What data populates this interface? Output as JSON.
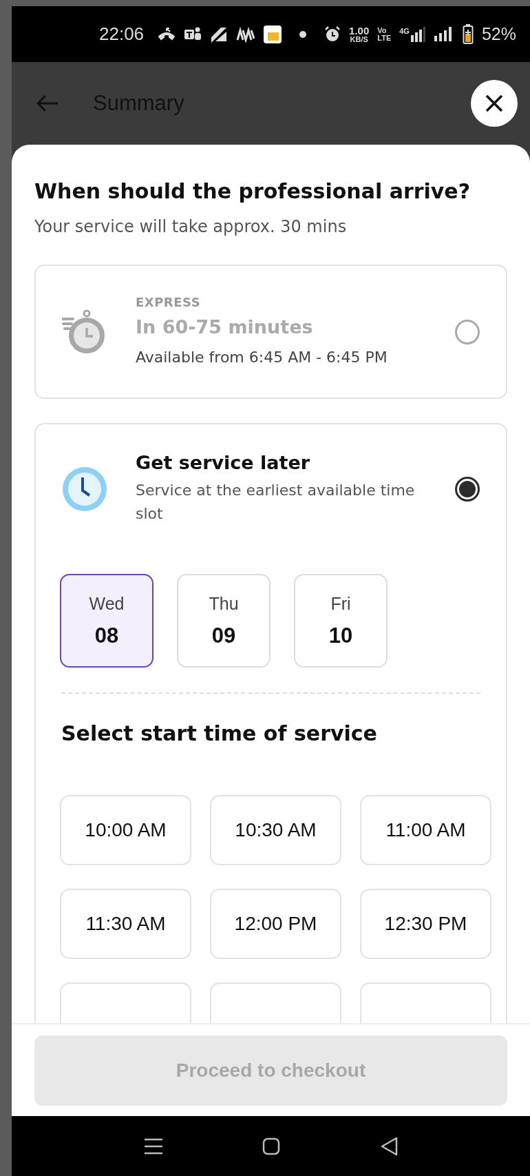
{
  "status_bar": {
    "time": "22:06",
    "speed_value": "1.00",
    "speed_unit": "KB/S",
    "volte_top": "Vo",
    "volte_bottom": "LTE",
    "network_type": "4G",
    "battery": "52%"
  },
  "header": {
    "title": "Summary"
  },
  "sheet": {
    "title": "When should the professional arrive?",
    "subtitle": "Your service will take approx. 30 mins",
    "options": [
      {
        "kind": "express",
        "tag": "EXPRESS",
        "title": "In 60-75 minutes",
        "detail": "Available from 6:45 AM - 6:45 PM",
        "selected": false,
        "disabled": true
      },
      {
        "kind": "later",
        "title": "Get service later",
        "detail": "Service at the earliest available time slot",
        "selected": true,
        "disabled": false
      }
    ],
    "dates": [
      {
        "day": "Wed",
        "date": "08",
        "selected": true
      },
      {
        "day": "Thu",
        "date": "09",
        "selected": false
      },
      {
        "day": "Fri",
        "date": "10",
        "selected": false
      }
    ],
    "time_heading": "Select start time of service",
    "time_slots": [
      {
        "time": "10:00 AM",
        "selected": false
      },
      {
        "time": "10:30 AM",
        "selected": false
      },
      {
        "time": "11:00 AM",
        "selected": false
      },
      {
        "time": "11:30 AM",
        "selected": false
      },
      {
        "time": "12:00 PM",
        "selected": false
      },
      {
        "time": "12:30 PM",
        "selected": false
      }
    ]
  },
  "footer": {
    "button": "Proceed to checkout",
    "disabled": true
  }
}
